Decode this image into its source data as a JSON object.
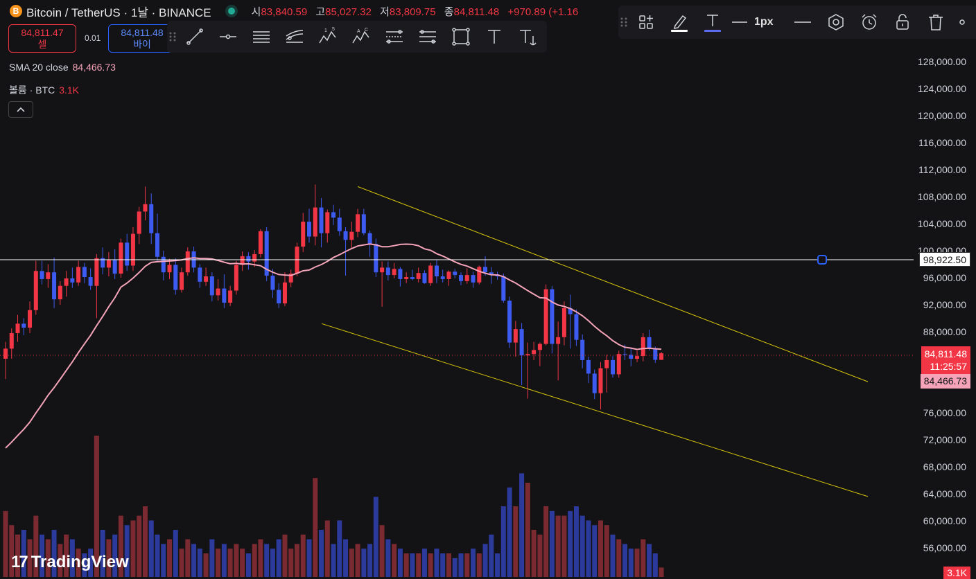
{
  "header": {
    "coin_icon": "B",
    "title": "Bitcoin / TetherUS · 1날 · BINANCE",
    "ohlc": [
      {
        "key": "시",
        "value": "83,840.59"
      },
      {
        "key": "고",
        "value": "85,027.32"
      },
      {
        "key": "저",
        "value": "83,809.75"
      },
      {
        "key": "종",
        "value": "84,811.48"
      }
    ],
    "change": "+970.89 (+1.16"
  },
  "trade": {
    "sell_price": "84,811.47",
    "sell_label": "셀",
    "spread": "0.01",
    "buy_price": "84,811.48",
    "buy_label": "바이"
  },
  "legend": {
    "sma_name": "SMA 20 close",
    "sma_value": "84,466.73",
    "vol_name": "볼륨 · BTC",
    "vol_value": "3.1K"
  },
  "drawing_toolbar": {
    "icons": [
      "trend-line-icon",
      "horizontal-ray-icon",
      "parallel-lines-icon",
      "fib-channel-icon",
      "elliott-wave-icon",
      "abcd-pattern-icon",
      "date-range-icon",
      "price-range-icon",
      "rectangle-icon",
      "text-icon",
      "anchored-text-icon"
    ]
  },
  "style_toolbar": {
    "line_width_label": "1px",
    "icons": [
      "template-icon",
      "pen-color-icon",
      "text-color-icon",
      "line-width-icon",
      "line-style-icon",
      "object-settings-icon",
      "alert-icon",
      "lock-icon",
      "delete-icon",
      "more-icon"
    ]
  },
  "price_axis": {
    "ticks": [
      "128,000.00",
      "124,000.00",
      "120,000.00",
      "116,000.00",
      "112,000.00",
      "108,000.00",
      "104,000.00",
      "100,000.00",
      "96,000.00",
      "92,000.00",
      "88,000.00",
      "76,000.00",
      "72,000.00",
      "68,000.00",
      "64,000.00",
      "60,000.00",
      "56,000.00"
    ],
    "horizontal_line_label": "98,922.50",
    "last_price": "84,811.48",
    "countdown": "11:25:57",
    "sma_label": "84,466.73",
    "volume_label": "3.1K"
  },
  "colors": {
    "up": "#f23645",
    "down": "#3d5af1",
    "sma": "#f4a3b8",
    "channel": "#d4c20b",
    "background": "#131316"
  },
  "branding": {
    "logo_text": "TradingView"
  },
  "chart_data": {
    "type": "candlestick",
    "symbol": "BTCUSDT",
    "interval": "1D",
    "y_axis_range": [
      54000,
      130000
    ],
    "horizontal_line": 98922.5,
    "last_price": 84811.48,
    "sma20_last": 84466.73,
    "channel": {
      "upper": [
        [
          0,
          109500
        ],
        [
          108,
          80600
        ]
      ],
      "lower": [
        [
          0,
          89200
        ],
        [
          108,
          63600
        ]
      ]
    },
    "candles": [
      [
        84000,
        86500,
        81000,
        85500,
        1.4
      ],
      [
        85500,
        88500,
        84000,
        87800,
        1.1
      ],
      [
        87800,
        90500,
        86500,
        89200,
        0.9
      ],
      [
        89200,
        90000,
        87500,
        88600,
        1.0
      ],
      [
        88600,
        92500,
        87800,
        91200,
        0.8
      ],
      [
        91200,
        98500,
        90500,
        97000,
        1.3
      ],
      [
        97000,
        98500,
        95000,
        95800,
        0.9
      ],
      [
        95800,
        98000,
        94500,
        96800,
        0.8
      ],
      [
        96800,
        99000,
        91500,
        92800,
        1.0
      ],
      [
        92800,
        95500,
        92000,
        94800,
        0.7
      ],
      [
        94800,
        97000,
        93200,
        95900,
        0.9
      ],
      [
        95900,
        97500,
        94500,
        95300,
        0.8
      ],
      [
        95300,
        98500,
        94800,
        97600,
        0.6
      ],
      [
        97600,
        98200,
        95200,
        96100,
        0.5
      ],
      [
        96100,
        97400,
        94200,
        94800,
        0.6
      ],
      [
        94800,
        99500,
        90000,
        98900,
        3.0
      ],
      [
        98900,
        100500,
        96500,
        97500,
        1.0
      ],
      [
        97500,
        99800,
        96200,
        98600,
        0.8
      ],
      [
        98600,
        100200,
        95800,
        96600,
        0.9
      ],
      [
        96600,
        101800,
        96000,
        101200,
        1.3
      ],
      [
        101200,
        102500,
        97000,
        97800,
        1.1
      ],
      [
        97800,
        103500,
        97000,
        102500,
        1.2
      ],
      [
        102500,
        106500,
        101000,
        105800,
        1.3
      ],
      [
        105800,
        109500,
        104500,
        106900,
        1.5
      ],
      [
        106900,
        108500,
        101000,
        102600,
        1.2
      ],
      [
        102600,
        105500,
        98500,
        99100,
        0.9
      ],
      [
        99100,
        100000,
        95600,
        96800,
        0.7
      ],
      [
        96800,
        98800,
        95800,
        97900,
        0.8
      ],
      [
        97900,
        98900,
        93500,
        94200,
        1.0
      ],
      [
        94200,
        97500,
        93800,
        96800,
        0.6
      ],
      [
        96800,
        100500,
        96300,
        99900,
        0.8
      ],
      [
        99900,
        100600,
        96800,
        97500,
        0.7
      ],
      [
        97500,
        98000,
        94500,
        95400,
        0.6
      ],
      [
        95400,
        97500,
        94800,
        96200,
        0.5
      ],
      [
        96200,
        96800,
        92500,
        93400,
        0.8
      ],
      [
        93400,
        95800,
        92600,
        94400,
        0.6
      ],
      [
        94400,
        96500,
        91500,
        92300,
        0.7
      ],
      [
        92300,
        94800,
        91800,
        94100,
        0.6
      ],
      [
        94100,
        98500,
        93500,
        97900,
        0.7
      ],
      [
        97900,
        99900,
        97000,
        99200,
        0.6
      ],
      [
        99200,
        99800,
        97200,
        98400,
        0.5
      ],
      [
        98400,
        100100,
        97600,
        99500,
        0.7
      ],
      [
        99500,
        103200,
        99000,
        102900,
        0.8
      ],
      [
        102900,
        103500,
        95500,
        96300,
        0.7
      ],
      [
        96300,
        97300,
        93000,
        94200,
        0.6
      ],
      [
        94200,
        95200,
        91500,
        92200,
        0.8
      ],
      [
        92200,
        96800,
        91800,
        95300,
        0.9
      ],
      [
        95300,
        97200,
        94600,
        96600,
        0.6
      ],
      [
        96600,
        101200,
        96200,
        100600,
        0.7
      ],
      [
        100600,
        105600,
        99800,
        104300,
        0.9
      ],
      [
        104300,
        106200,
        101200,
        102100,
        0.8
      ],
      [
        102100,
        109800,
        100800,
        106400,
        2.1
      ],
      [
        106400,
        107800,
        100500,
        102600,
        1.0
      ],
      [
        102600,
        106100,
        101200,
        105700,
        1.2
      ],
      [
        105700,
        106800,
        103800,
        104900,
        0.7
      ],
      [
        104900,
        106200,
        102200,
        102900,
        1.2
      ],
      [
        102900,
        103500,
        96300,
        101600,
        0.8
      ],
      [
        101600,
        104300,
        100400,
        102800,
        0.6
      ],
      [
        102800,
        106200,
        102000,
        105400,
        0.7
      ],
      [
        105400,
        106200,
        102300,
        102600,
        0.6
      ],
      [
        102600,
        103000,
        99100,
        101000,
        0.7
      ],
      [
        101000,
        101800,
        96100,
        96800,
        1.7
      ],
      [
        96800,
        98400,
        91700,
        97500,
        1.1
      ],
      [
        97500,
        98400,
        95600,
        96400,
        0.8
      ],
      [
        96400,
        98200,
        95900,
        97300,
        0.7
      ],
      [
        97300,
        97600,
        94700,
        95800,
        0.6
      ],
      [
        95800,
        96800,
        95200,
        96100,
        0.5
      ],
      [
        96100,
        97200,
        95600,
        95800,
        0.5
      ],
      [
        95800,
        97500,
        95300,
        96700,
        0.5
      ],
      [
        96700,
        97100,
        95100,
        95200,
        0.6
      ],
      [
        95200,
        98200,
        94800,
        97800,
        0.5
      ],
      [
        97800,
        98600,
        95200,
        96200,
        0.6
      ],
      [
        96200,
        97200,
        95300,
        95800,
        0.5
      ],
      [
        95800,
        97100,
        94800,
        96900,
        0.5
      ],
      [
        96900,
        97300,
        95900,
        96400,
        0.4
      ],
      [
        96400,
        96800,
        94900,
        95500,
        0.5
      ],
      [
        95500,
        97400,
        95100,
        96400,
        0.5
      ],
      [
        96400,
        96900,
        94500,
        95300,
        0.6
      ],
      [
        95300,
        97800,
        95000,
        97600,
        0.5
      ],
      [
        97600,
        99200,
        96300,
        96800,
        0.7
      ],
      [
        96800,
        97600,
        95100,
        96500,
        0.9
      ],
      [
        96500,
        96900,
        95700,
        96200,
        0.5
      ],
      [
        96200,
        96600,
        92300,
        92600,
        1.5
      ],
      [
        92600,
        93200,
        85600,
        86400,
        1.9
      ],
      [
        86400,
        89600,
        84300,
        88400,
        1.5
      ],
      [
        88400,
        89300,
        80100,
        84500,
        2.2
      ],
      [
        84500,
        86400,
        78100,
        84700,
        2.0
      ],
      [
        84700,
        86500,
        83800,
        85300,
        1.0
      ],
      [
        85300,
        86400,
        82900,
        86200,
        0.9
      ],
      [
        86200,
        95000,
        86000,
        94300,
        1.5
      ],
      [
        94300,
        94800,
        84800,
        86200,
        1.4
      ],
      [
        86200,
        89500,
        80800,
        87200,
        1.3
      ],
      [
        87200,
        92500,
        86000,
        91500,
        1.3
      ],
      [
        91500,
        93500,
        85500,
        90600,
        1.4
      ],
      [
        90600,
        91300,
        85900,
        86800,
        1.5
      ],
      [
        86800,
        87600,
        82600,
        83800,
        1.3
      ],
      [
        83800,
        84300,
        80400,
        81800,
        1.2
      ],
      [
        81800,
        82400,
        78000,
        78900,
        1.1
      ],
      [
        78900,
        83500,
        76500,
        82600,
        1.2
      ],
      [
        82600,
        84600,
        79000,
        83800,
        1.1
      ],
      [
        83800,
        84400,
        81200,
        81700,
        0.9
      ],
      [
        81700,
        85200,
        81200,
        84700,
        0.8
      ],
      [
        84700,
        86100,
        83800,
        84600,
        0.7
      ],
      [
        84600,
        85600,
        82900,
        84000,
        0.6
      ],
      [
        84000,
        85200,
        83500,
        84400,
        0.6
      ],
      [
        84400,
        87800,
        83600,
        87200,
        0.8
      ],
      [
        87200,
        88300,
        85200,
        85500,
        0.7
      ],
      [
        85500,
        85800,
        83400,
        83840,
        0.5
      ],
      [
        83840,
        85027,
        83809,
        84811,
        0.2
      ]
    ]
  }
}
